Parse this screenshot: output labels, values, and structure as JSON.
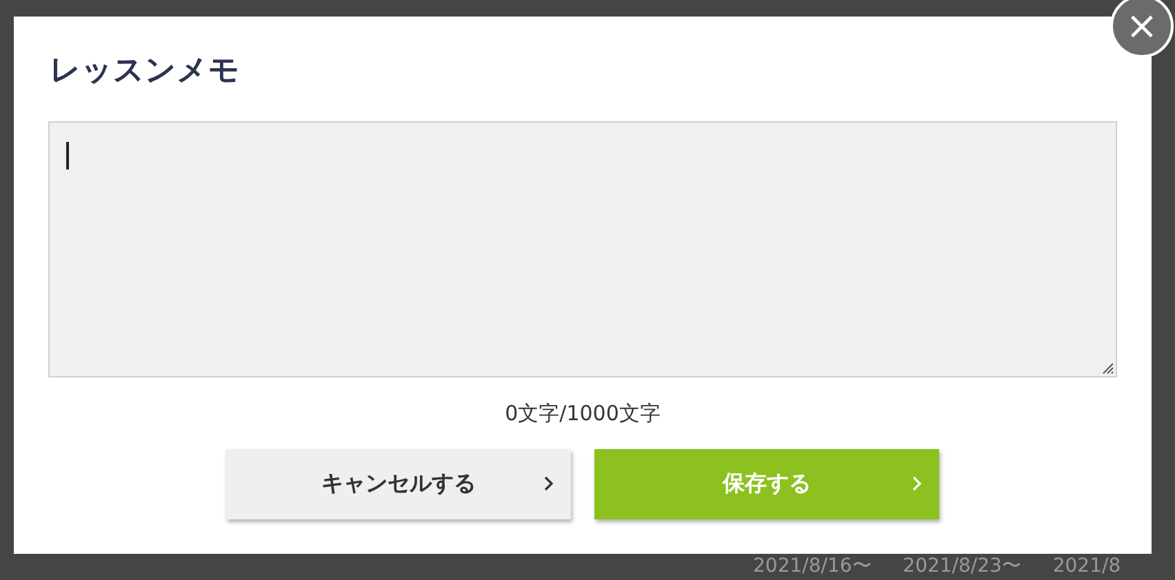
{
  "background": {
    "week_labels": [
      "2021/8/16〜",
      "2021/8/23〜",
      "2021/8"
    ]
  },
  "dialog": {
    "title": "レッスンメモ",
    "close_label": "×",
    "memo_field": {
      "focused": true
    },
    "counter": "0文字/1000文字",
    "buttons": [
      {
        "label": "キャンセルする",
        "kind": "secondary"
      },
      {
        "label": "保存する",
        "kind": "primary"
      }
    ]
  }
}
